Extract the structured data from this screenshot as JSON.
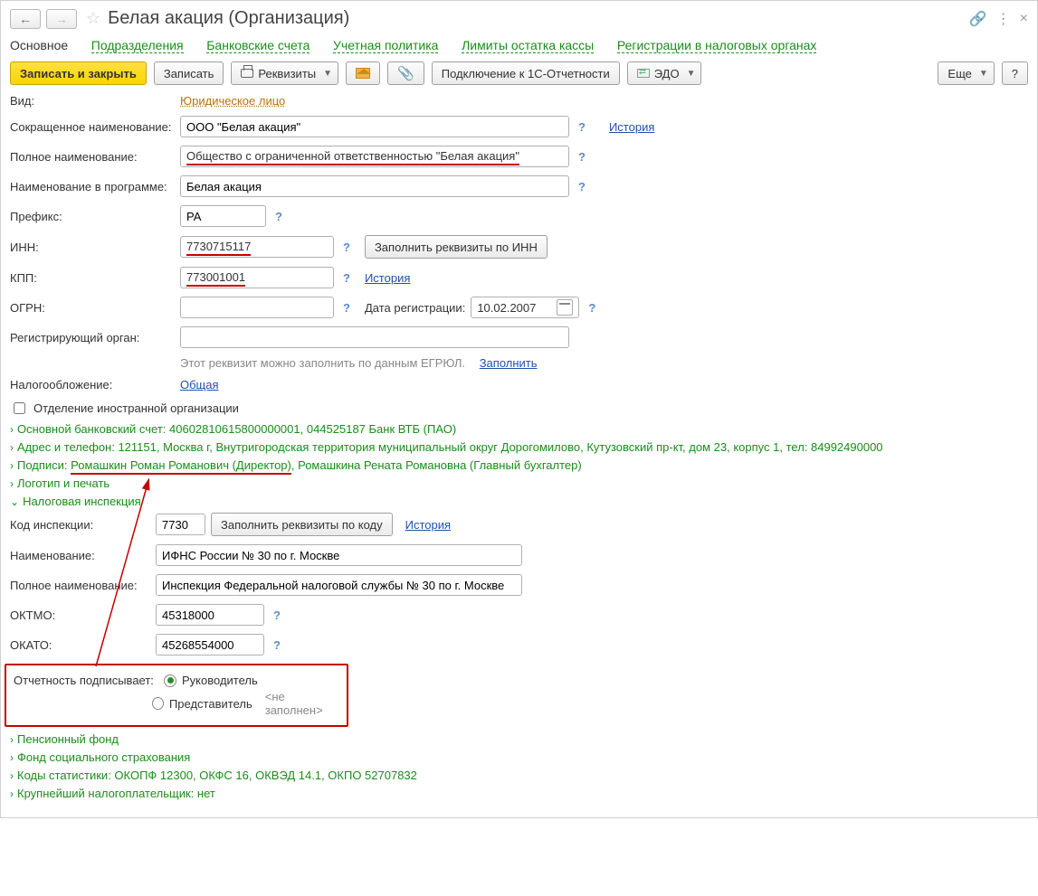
{
  "header": {
    "title": "Белая акация (Организация)"
  },
  "tabs": {
    "main": "Основное",
    "subdivisions": "Подразделения",
    "bank_accounts": "Банковские счета",
    "accounting_policy": "Учетная политика",
    "cash_limits": "Лимиты остатка кассы",
    "tax_registrations": "Регистрации в налоговых органах"
  },
  "toolbar": {
    "save_close": "Записать и закрыть",
    "save": "Записать",
    "requisites": "Реквизиты",
    "connect_1c": "Подключение к 1С-Отчетности",
    "edo": "ЭДО",
    "more": "Еще",
    "help": "?"
  },
  "form": {
    "kind_label": "Вид:",
    "kind_value": "Юридическое лицо",
    "short_name_label": "Сокращенное наименование:",
    "short_name_value": "ООО \"Белая акация\"",
    "history": "История",
    "full_name_label": "Полное наименование:",
    "full_name_value": "Общество с ограниченной ответственностью \"Белая акация\"",
    "prog_name_label": "Наименование в программе:",
    "prog_name_value": "Белая акация",
    "prefix_label": "Префикс:",
    "prefix_value": "РА",
    "inn_label": "ИНН:",
    "inn_value": "7730715117",
    "fill_by_inn": "Заполнить реквизиты по ИНН",
    "kpp_label": "КПП:",
    "kpp_value": "773001001",
    "ogrn_label": "ОГРН:",
    "ogrn_value": "",
    "reg_date_label": "Дата регистрации:",
    "reg_date_value": "10.02.2007",
    "reg_body_label": "Регистрирующий орган:",
    "reg_body_value": "",
    "egrul_hint": "Этот реквизит можно заполнить по данным ЕГРЮЛ.",
    "egrul_fill": "Заполнить",
    "taxation_label": "Налогообложение:",
    "taxation_value": "Общая",
    "foreign_branch": "Отделение иностранной организации"
  },
  "sections": {
    "bank": "Основной банковский счет: 40602810615800000001, 044525187 Банк ВТБ (ПАО)",
    "address": "Адрес и телефон: 121151, Москва г, Внутригородская территория муниципальный округ Дорогомилово, Кутузовский пр-кт, дом 23, корпус 1, тел: 84992490000",
    "signatures_prefix": "Подписи: ",
    "signatures_director": "Ромашкин Роман Романович (Директор)",
    "signatures_rest": ", Ромашкина Рената Романовна (Главный бухгалтер)",
    "logo": "Логотип и печать",
    "tax_inspection": "Налоговая инспекция",
    "pension": "Пенсионный фонд",
    "fss": "Фонд социального страхования",
    "stats": "Коды статистики: ОКОПФ 12300, ОКФС 16, ОКВЭД 14.1, ОКПО 52707832",
    "biggest": "Крупнейший налогоплательщик: нет"
  },
  "tax_insp": {
    "code_label": "Код инспекции:",
    "code_value": "7730",
    "fill_by_code": "Заполнить реквизиты по коду",
    "history": "История",
    "name_label": "Наименование:",
    "name_value": "ИФНС России № 30 по г. Москве",
    "full_label": "Полное наименование:",
    "full_value": "Инспекция Федеральной налоговой службы № 30 по г. Москве",
    "oktmo_label": "ОКТМО:",
    "oktmo_value": "45318000",
    "okato_label": "ОКАТО:",
    "okato_value": "45268554000",
    "signs_label": "Отчетность подписывает:",
    "radio_head": "Руководитель",
    "radio_rep": "Представитель",
    "rep_empty": "<не заполнен>"
  }
}
